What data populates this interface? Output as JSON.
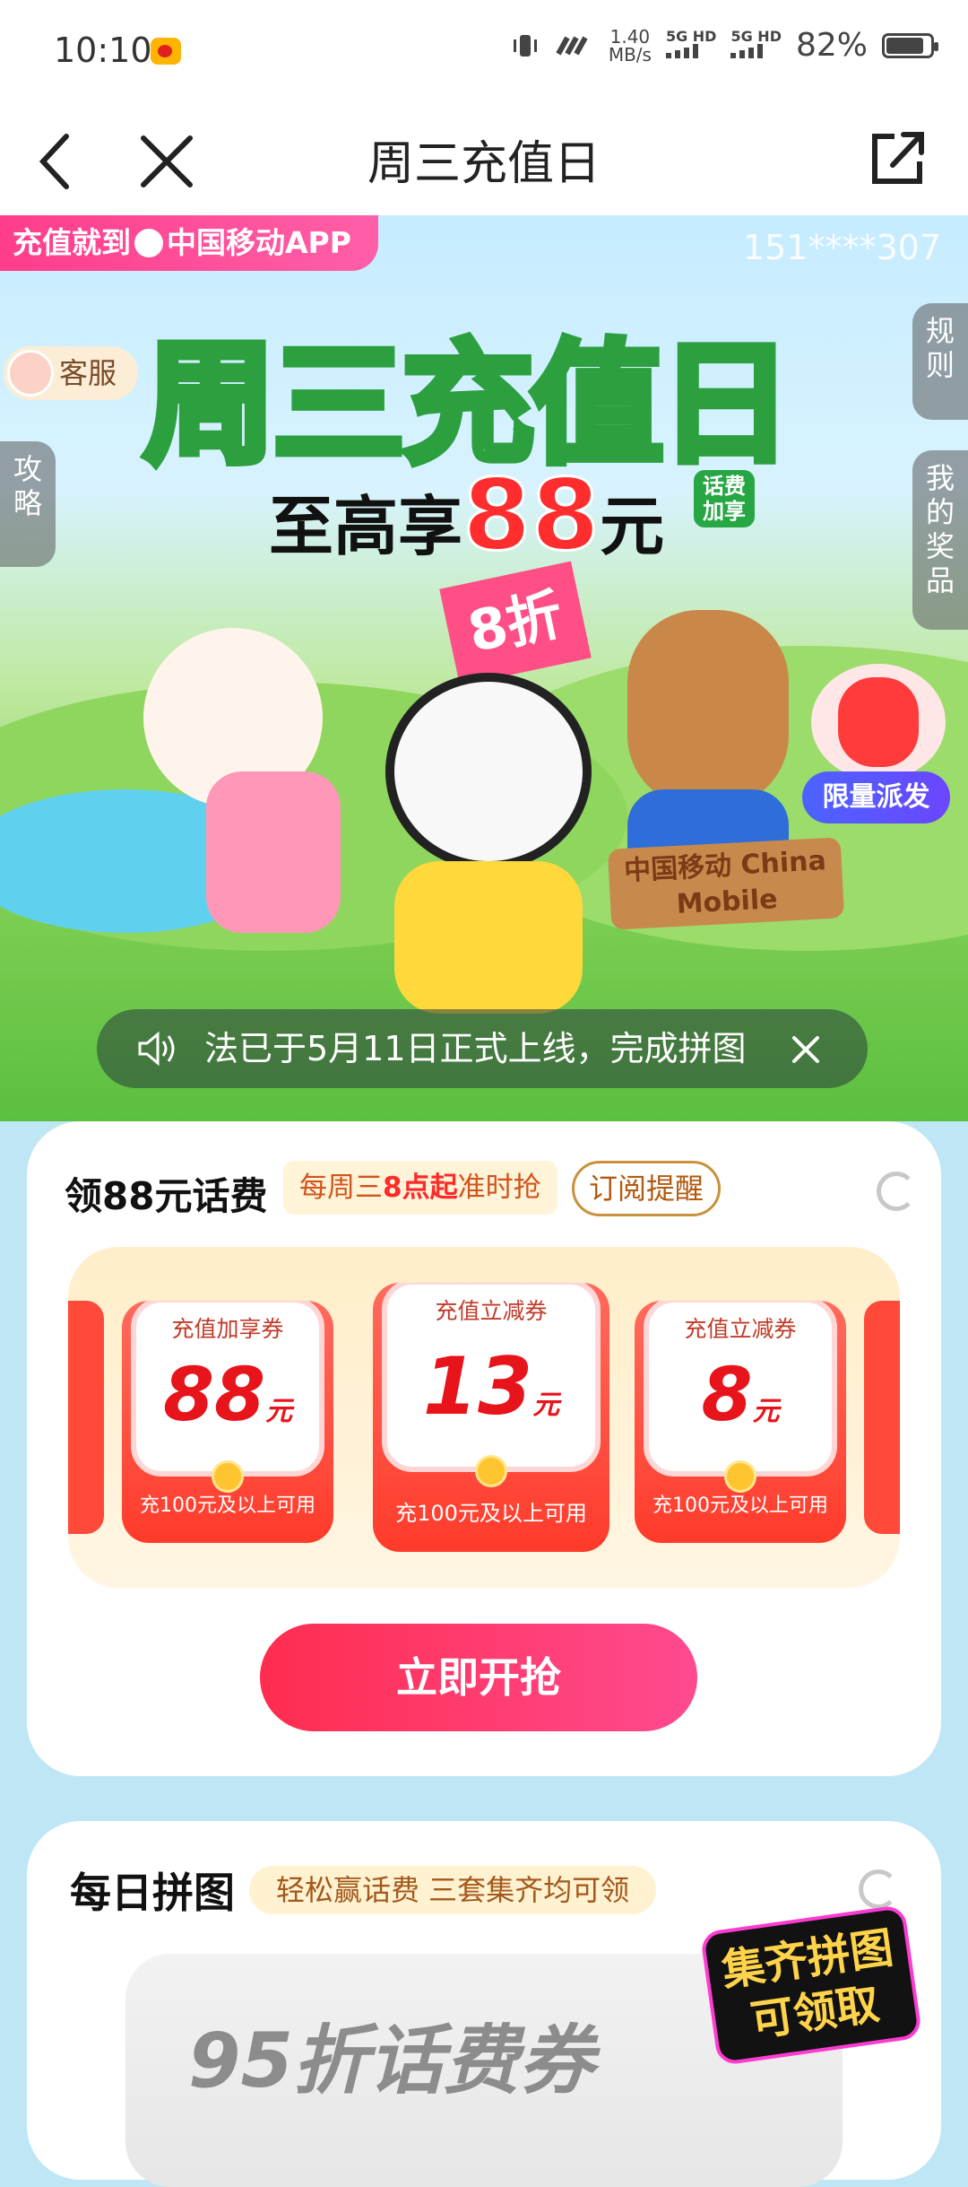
{
  "status_bar": {
    "time": "10:10",
    "speed_value": "1.40",
    "speed_unit": "MB/s",
    "net1": "5G HD",
    "net2": "5G HD",
    "battery": "82%"
  },
  "nav": {
    "title": "周三充值日"
  },
  "banner": {
    "app_tag": "充值就到",
    "app_name": "中国移动APP",
    "phone": "151****307",
    "customer_service": "客服",
    "rules": "规则",
    "guide": "攻略",
    "my_prizes": "我的奖品",
    "title": "周三充值日",
    "subtitle_prefix": "至高享",
    "subtitle_amount": "88",
    "subtitle_unit": "元",
    "subtitle_tag": "话费加享",
    "flag_text": "8折",
    "sign_text": "中国移动 China Mobile",
    "limited_badge": "限量派发",
    "marquee": "法已于5月11日正式上线，完成拼图"
  },
  "coupon_card": {
    "title": "领88元话费",
    "tip_prefix": "每周三",
    "tip_highlight": "8点起",
    "tip_suffix": "准时抢",
    "subscribe": "订阅提醒",
    "coupons": [
      {
        "name": "充值加享券",
        "value": "88",
        "unit": "元",
        "condition": "充100元及以上可用"
      },
      {
        "name": "充值立减券",
        "value": "13",
        "unit": "元",
        "condition": "充100元及以上可用"
      },
      {
        "name": "充值立减券",
        "value": "8",
        "unit": "元",
        "condition": "充100元及以上可用"
      }
    ],
    "grab_button": "立即开抢"
  },
  "puzzle_card": {
    "title": "每日拼图",
    "tip": "轻松赢话费 三套集齐均可领",
    "badge": "集齐拼图可领取",
    "puzzle_label": "95折话费券"
  },
  "colors": {
    "accent_pink": "#ff3d8b",
    "grab_gradient_start": "#ff2d4f",
    "grab_gradient_end": "#ff4a90",
    "limited_blue": "#4c63ff",
    "coupon_red": "#e8141b"
  }
}
